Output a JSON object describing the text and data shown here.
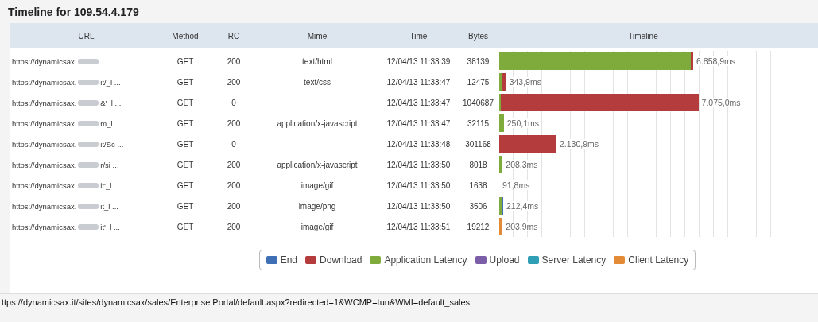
{
  "title": "Timeline for 109.54.4.179",
  "table": {
    "columns": [
      "URL",
      "Method",
      "RC",
      "Mime",
      "Time",
      "Bytes",
      "Timeline"
    ],
    "rows": [
      {
        "url_start": "https://dynamicsax.",
        "url_end": "...",
        "method": "GET",
        "rc": "200",
        "mime": "text/html",
        "time": "12/04/13 11:33:39",
        "bytes": "38139",
        "duration": "6.858,9ms",
        "segments": [
          {
            "kind": "application",
            "level": 0.67
          },
          {
            "kind": "download",
            "level": 0.008
          }
        ]
      },
      {
        "url_start": "https://dynamicsax.",
        "url_end": "it/_l ...",
        "method": "GET",
        "rc": "200",
        "mime": "text/css",
        "time": "12/04/13 11:33:47",
        "bytes": "12475",
        "duration": "343,9ms",
        "segments": [
          {
            "kind": "application",
            "level": 0.012
          },
          {
            "kind": "download",
            "level": 0.012
          }
        ]
      },
      {
        "url_start": "https://dynamicsax.",
        "url_end": "&'_l ...",
        "method": "GET",
        "rc": "0",
        "mime": "",
        "time": "12/04/13 11:33:47",
        "bytes": "1040687",
        "duration": "7.075,0ms",
        "segments": [
          {
            "kind": "application",
            "level": 0.006
          },
          {
            "kind": "download",
            "level": 0.69
          }
        ]
      },
      {
        "url_start": "https://dynamicsax.",
        "url_end": "m_l ...",
        "method": "GET",
        "rc": "200",
        "mime": "application/x-javascript",
        "time": "12/04/13 11:33:47",
        "bytes": "32115",
        "duration": "250,1ms",
        "segments": [
          {
            "kind": "application",
            "level": 0.016
          }
        ]
      },
      {
        "url_start": "https://dynamicsax.",
        "url_end": "it/Sc ...",
        "method": "GET",
        "rc": "0",
        "mime": "",
        "time": "12/04/13 11:33:48",
        "bytes": "301168",
        "duration": "2.130,9ms",
        "segments": [
          {
            "kind": "download",
            "level": 0.2
          }
        ]
      },
      {
        "url_start": "https://dynamicsax.",
        "url_end": "r/si ...",
        "method": "GET",
        "rc": "200",
        "mime": "application/x-javascript",
        "time": "12/04/13 11:33:50",
        "bytes": "8018",
        "duration": "208,3ms",
        "segments": [
          {
            "kind": "application",
            "level": 0.012
          }
        ]
      },
      {
        "url_start": "https://dynamicsax.",
        "url_end": "it'_l ...",
        "method": "GET",
        "rc": "200",
        "mime": "image/gif",
        "time": "12/04/13 11:33:50",
        "bytes": "1638",
        "duration": "91,8ms",
        "segments": []
      },
      {
        "url_start": "https://dynamicsax.",
        "url_end": "it_l ...",
        "method": "GET",
        "rc": "200",
        "mime": "image/png",
        "time": "12/04/13 11:33:50",
        "bytes": "3506",
        "duration": "212,4ms",
        "segments": [
          {
            "kind": "application",
            "level": 0.01
          },
          {
            "kind": "end",
            "level": 0.004
          }
        ]
      },
      {
        "url_start": "https://dynamicsax.",
        "url_end": "it'_l ...",
        "method": "GET",
        "rc": "200",
        "mime": "image/gif",
        "time": "12/04/13 11:33:51",
        "bytes": "19212",
        "duration": "203,9ms",
        "segments": [
          {
            "kind": "client",
            "level": 0.012
          }
        ]
      }
    ]
  },
  "legend": [
    {
      "label": "End",
      "color": "#3f6fb5"
    },
    {
      "label": "Download",
      "color": "#b43c3c"
    },
    {
      "label": "Application Latency",
      "color": "#7fab3c"
    },
    {
      "label": "Upload",
      "color": "#7b5ea7"
    },
    {
      "label": "Server Latency",
      "color": "#2f9fb5"
    },
    {
      "label": "Client Latency",
      "color": "#e38a37"
    }
  ],
  "status_bar": "ttps://dynamicsax.it/sites/dynamicsax/sales/Enterprise Portal/default.aspx?redirected=1&WCMP=tun&WMI=default_sales"
}
